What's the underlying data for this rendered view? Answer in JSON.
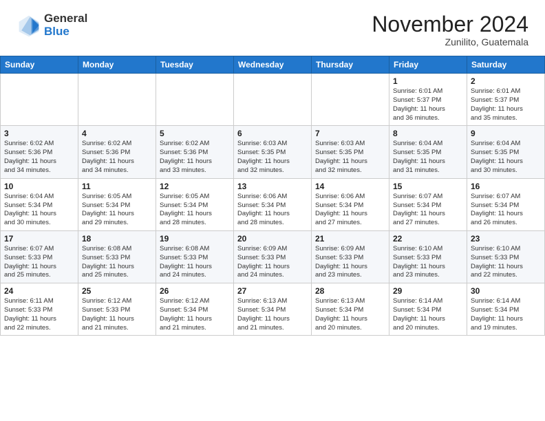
{
  "header": {
    "logo_general": "General",
    "logo_blue": "Blue",
    "month_title": "November 2024",
    "location": "Zunilito, Guatemala"
  },
  "calendar": {
    "days_of_week": [
      "Sunday",
      "Monday",
      "Tuesday",
      "Wednesday",
      "Thursday",
      "Friday",
      "Saturday"
    ],
    "weeks": [
      [
        {
          "day": "",
          "info": ""
        },
        {
          "day": "",
          "info": ""
        },
        {
          "day": "",
          "info": ""
        },
        {
          "day": "",
          "info": ""
        },
        {
          "day": "",
          "info": ""
        },
        {
          "day": "1",
          "info": "Sunrise: 6:01 AM\nSunset: 5:37 PM\nDaylight: 11 hours\nand 36 minutes."
        },
        {
          "day": "2",
          "info": "Sunrise: 6:01 AM\nSunset: 5:37 PM\nDaylight: 11 hours\nand 35 minutes."
        }
      ],
      [
        {
          "day": "3",
          "info": "Sunrise: 6:02 AM\nSunset: 5:36 PM\nDaylight: 11 hours\nand 34 minutes."
        },
        {
          "day": "4",
          "info": "Sunrise: 6:02 AM\nSunset: 5:36 PM\nDaylight: 11 hours\nand 34 minutes."
        },
        {
          "day": "5",
          "info": "Sunrise: 6:02 AM\nSunset: 5:36 PM\nDaylight: 11 hours\nand 33 minutes."
        },
        {
          "day": "6",
          "info": "Sunrise: 6:03 AM\nSunset: 5:35 PM\nDaylight: 11 hours\nand 32 minutes."
        },
        {
          "day": "7",
          "info": "Sunrise: 6:03 AM\nSunset: 5:35 PM\nDaylight: 11 hours\nand 32 minutes."
        },
        {
          "day": "8",
          "info": "Sunrise: 6:04 AM\nSunset: 5:35 PM\nDaylight: 11 hours\nand 31 minutes."
        },
        {
          "day": "9",
          "info": "Sunrise: 6:04 AM\nSunset: 5:35 PM\nDaylight: 11 hours\nand 30 minutes."
        }
      ],
      [
        {
          "day": "10",
          "info": "Sunrise: 6:04 AM\nSunset: 5:34 PM\nDaylight: 11 hours\nand 30 minutes."
        },
        {
          "day": "11",
          "info": "Sunrise: 6:05 AM\nSunset: 5:34 PM\nDaylight: 11 hours\nand 29 minutes."
        },
        {
          "day": "12",
          "info": "Sunrise: 6:05 AM\nSunset: 5:34 PM\nDaylight: 11 hours\nand 28 minutes."
        },
        {
          "day": "13",
          "info": "Sunrise: 6:06 AM\nSunset: 5:34 PM\nDaylight: 11 hours\nand 28 minutes."
        },
        {
          "day": "14",
          "info": "Sunrise: 6:06 AM\nSunset: 5:34 PM\nDaylight: 11 hours\nand 27 minutes."
        },
        {
          "day": "15",
          "info": "Sunrise: 6:07 AM\nSunset: 5:34 PM\nDaylight: 11 hours\nand 27 minutes."
        },
        {
          "day": "16",
          "info": "Sunrise: 6:07 AM\nSunset: 5:34 PM\nDaylight: 11 hours\nand 26 minutes."
        }
      ],
      [
        {
          "day": "17",
          "info": "Sunrise: 6:07 AM\nSunset: 5:33 PM\nDaylight: 11 hours\nand 25 minutes."
        },
        {
          "day": "18",
          "info": "Sunrise: 6:08 AM\nSunset: 5:33 PM\nDaylight: 11 hours\nand 25 minutes."
        },
        {
          "day": "19",
          "info": "Sunrise: 6:08 AM\nSunset: 5:33 PM\nDaylight: 11 hours\nand 24 minutes."
        },
        {
          "day": "20",
          "info": "Sunrise: 6:09 AM\nSunset: 5:33 PM\nDaylight: 11 hours\nand 24 minutes."
        },
        {
          "day": "21",
          "info": "Sunrise: 6:09 AM\nSunset: 5:33 PM\nDaylight: 11 hours\nand 23 minutes."
        },
        {
          "day": "22",
          "info": "Sunrise: 6:10 AM\nSunset: 5:33 PM\nDaylight: 11 hours\nand 23 minutes."
        },
        {
          "day": "23",
          "info": "Sunrise: 6:10 AM\nSunset: 5:33 PM\nDaylight: 11 hours\nand 22 minutes."
        }
      ],
      [
        {
          "day": "24",
          "info": "Sunrise: 6:11 AM\nSunset: 5:33 PM\nDaylight: 11 hours\nand 22 minutes."
        },
        {
          "day": "25",
          "info": "Sunrise: 6:12 AM\nSunset: 5:33 PM\nDaylight: 11 hours\nand 21 minutes."
        },
        {
          "day": "26",
          "info": "Sunrise: 6:12 AM\nSunset: 5:34 PM\nDaylight: 11 hours\nand 21 minutes."
        },
        {
          "day": "27",
          "info": "Sunrise: 6:13 AM\nSunset: 5:34 PM\nDaylight: 11 hours\nand 21 minutes."
        },
        {
          "day": "28",
          "info": "Sunrise: 6:13 AM\nSunset: 5:34 PM\nDaylight: 11 hours\nand 20 minutes."
        },
        {
          "day": "29",
          "info": "Sunrise: 6:14 AM\nSunset: 5:34 PM\nDaylight: 11 hours\nand 20 minutes."
        },
        {
          "day": "30",
          "info": "Sunrise: 6:14 AM\nSunset: 5:34 PM\nDaylight: 11 hours\nand 19 minutes."
        }
      ]
    ]
  }
}
